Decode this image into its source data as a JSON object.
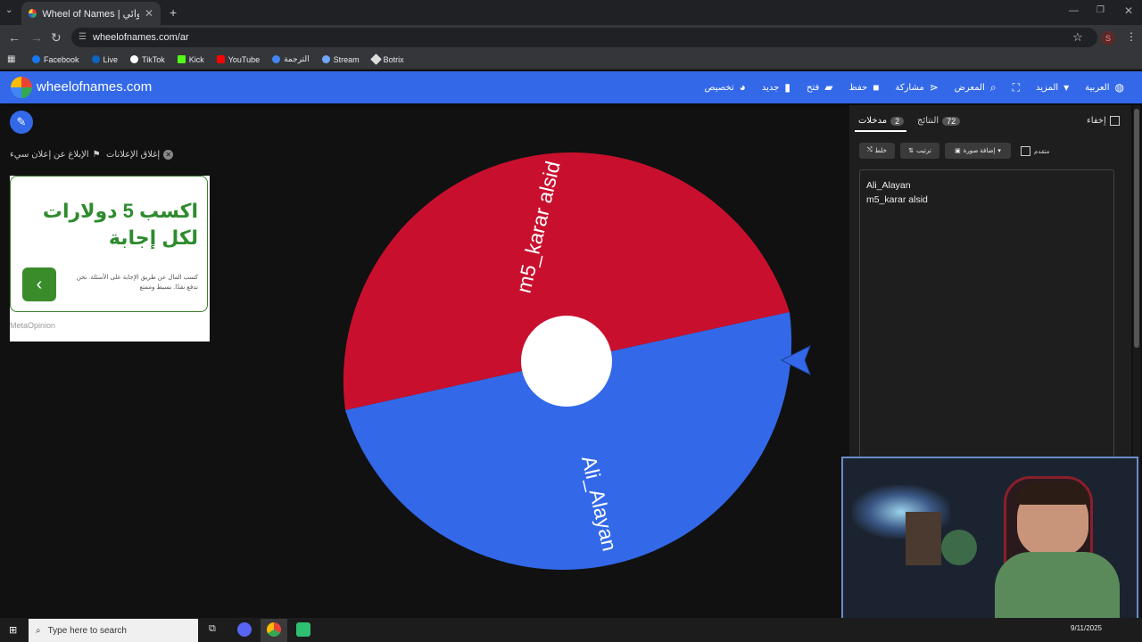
{
  "browser": {
    "tab_title": "Wheel of Names | اسم العشوائي",
    "url": "wheelofnames.com/ar",
    "profile_initial": "S",
    "bookmarks": [
      {
        "label": "Facebook",
        "color": "#1877f2"
      },
      {
        "label": "Live",
        "color": "#0a66c2"
      },
      {
        "label": "TikTok",
        "color": "#ffffff"
      },
      {
        "label": "Kick",
        "color": "#53fc18"
      },
      {
        "label": "YouTube",
        "color": "#ff0000"
      },
      {
        "label": "الترجمة",
        "color": "#4285f4"
      },
      {
        "label": "Stream",
        "color": "#6ea8fe"
      },
      {
        "label": "Botrix",
        "color": "#dddddd"
      }
    ]
  },
  "header": {
    "site_name": "wheelofnames.com",
    "menu": [
      {
        "label": "تخصيص",
        "icon": "palette-icon"
      },
      {
        "label": "جديد",
        "icon": "file-icon"
      },
      {
        "label": "فتح",
        "icon": "folder-icon"
      },
      {
        "label": "حفظ",
        "icon": "save-icon"
      },
      {
        "label": "مشاركة",
        "icon": "share-icon"
      },
      {
        "label": "المعرض",
        "icon": "search-icon"
      },
      {
        "label": "",
        "icon": "fullscreen-icon"
      },
      {
        "label": "المزيد",
        "icon": "caret-down-icon"
      },
      {
        "label": "العربية",
        "icon": "globe-icon"
      }
    ]
  },
  "ads": {
    "close_ads": "إغلاق الإعلانات",
    "report_ad": "الإبلاغ عن إعلان سيء",
    "title": "اكسب 5 دولارات لكل إجابة",
    "body": "كسب المال عن طريق الإجابة على الأسئلة. نحن ندفع نقدًا. بسيط وممتع",
    "brand": "MetaOpinion"
  },
  "wheel": {
    "segments": [
      {
        "label": "m5_karar alsid",
        "color": "#c8102e"
      },
      {
        "label": "Ali_Alayan",
        "color": "#3369e8"
      }
    ],
    "center_color": "#ffffff",
    "pointer_color": "#3369e8"
  },
  "panel": {
    "tabs": [
      {
        "label": "مدخلات",
        "count": "2"
      },
      {
        "label": "النتائج",
        "count": "72"
      }
    ],
    "hide_label": "إخفاء",
    "toolbar": {
      "shuffle": "خلط",
      "sort": "ترتيب",
      "add_image": "إضافة صورة",
      "advanced": "متقدم"
    },
    "entries": [
      "Ali_Alayan",
      "m5_karar alsid"
    ]
  },
  "taskbar": {
    "search_placeholder": "Type here to search",
    "date": "9/11/2025"
  }
}
